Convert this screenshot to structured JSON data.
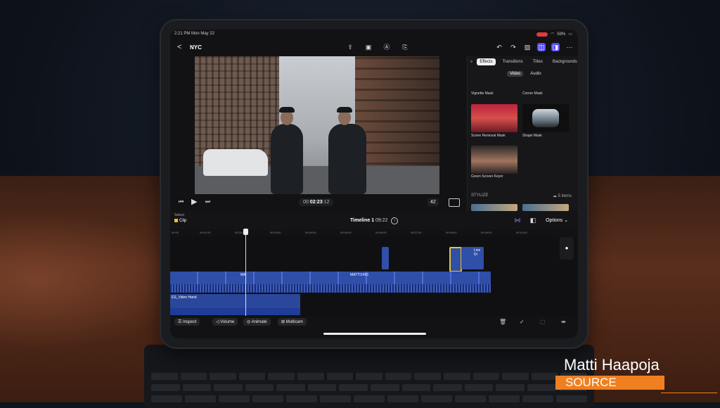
{
  "status": {
    "time": "2:21 PM  Mon May 22",
    "battery": "59%"
  },
  "header": {
    "back": "<",
    "project": "NYC"
  },
  "viewer": {
    "timecode_dim": "00:",
    "timecode_main": "02:23",
    "timecode_frames": ":12",
    "zoom": "42"
  },
  "browser": {
    "tabs": [
      "Effects",
      "Transitions",
      "Titles",
      "Backgrounds"
    ],
    "subtabs": [
      "Video",
      "Audio"
    ],
    "effects": [
      "Vignette Mask",
      "Corner Mask",
      "Scene Removal Mask",
      "Shape Mask",
      "Green Screen Keyer"
    ],
    "section": "STYLIZE",
    "section_count": "5 items"
  },
  "timeline": {
    "select": "Select",
    "clip": "Clip",
    "title": "Timeline 1",
    "duration": "09:22",
    "options": "Options",
    "ruler": [
      "00:00",
      "00:01:00",
      "00:02:00",
      "00:03:00",
      "00:04:00",
      "00:05:00",
      "00:06:00",
      "00:07:00",
      "00:08:00",
      "00:09:00",
      "00:10:00"
    ],
    "clip_labels": [
      "MA",
      "MATTI1493",
      "Live Dr"
    ],
    "audio_clip": "ES_Video Hand"
  },
  "bottom": {
    "inspect": "Inspect",
    "volume": "Volume",
    "animate": "Animate",
    "multicam": "Multicam"
  },
  "lower_third": {
    "name": "Matti Haapoja",
    "source": "SOURCE"
  },
  "colors": {
    "accent": "#5a4cf0",
    "clip": "#2f4fa8",
    "selection": "#e6c42a",
    "lower_third": "#f07f1f"
  }
}
